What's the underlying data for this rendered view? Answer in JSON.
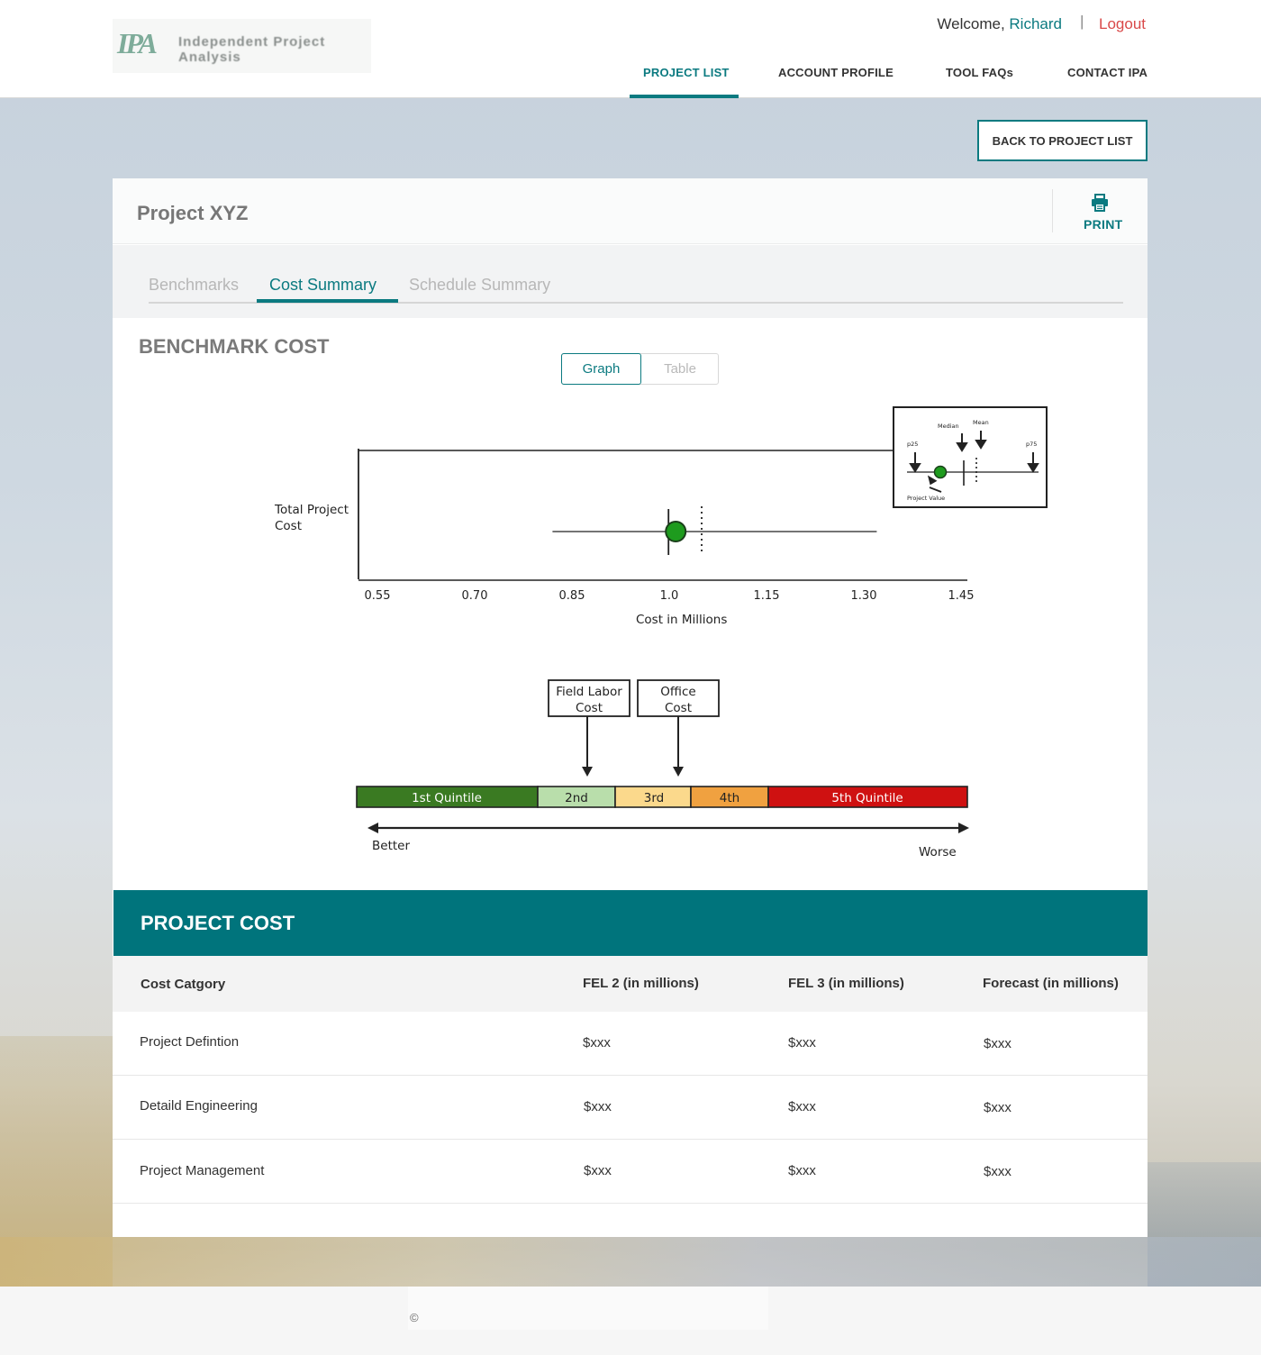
{
  "header": {
    "welcome_prefix": "Welcome,",
    "user_name": "Richard",
    "separator": "|",
    "logout_label": "Logout",
    "nav": [
      "PROJECT LIST",
      "ACCOUNT PROFILE",
      "TOOL FAQs",
      "CONTACT IPA"
    ],
    "active_nav": "PROJECT LIST"
  },
  "back_button_label": "BACK TO PROJECT LIST",
  "project": {
    "title": "Project XYZ",
    "print_label": "PRINT",
    "tabs": [
      "Benchmarks",
      "Cost Summary",
      "Schedule Summary"
    ],
    "active_tab": "Cost Summary"
  },
  "benchmark": {
    "title": "BENCHMARK COST",
    "toggle": {
      "graph_label": "Graph",
      "table_label": "Table",
      "active": "Graph"
    },
    "chart": {
      "y_label_line1": "Total Project",
      "y_label_line2": "Cost",
      "x_label": "Cost in Millions",
      "x_ticks": [
        "0.55",
        "0.70",
        "0.85",
        "1.0",
        "1.15",
        "1.30",
        "1.45"
      ],
      "project_value": 1.01,
      "mean_value": 1.05,
      "range_min": 0.82,
      "range_max": 1.32,
      "legend": {
        "median": "Median",
        "mean": "Mean",
        "p25": "p25",
        "p75": "p75",
        "project_value": "Project Value"
      }
    },
    "quintile": {
      "callouts": [
        {
          "line1": "Field Labor",
          "line2": "Cost"
        },
        {
          "line1": "Office",
          "line2": "Cost"
        }
      ],
      "bands": [
        {
          "label": "1st Quintile",
          "color": "#3a7a22"
        },
        {
          "label": "2nd",
          "color": "#b9deab"
        },
        {
          "label": "3rd",
          "color": "#fbd98c"
        },
        {
          "label": "4th",
          "color": "#f0a140"
        },
        {
          "label": "5th Quintile",
          "color": "#cf1111"
        }
      ],
      "better_label": "Better",
      "worse_label": "Worse"
    }
  },
  "project_cost": {
    "title": "PROJECT COST",
    "columns": [
      "Cost Catgory",
      "FEL 2 (in millions)",
      "FEL 3 (in millions)",
      "Forecast (in millions)"
    ],
    "rows": [
      [
        "Project Defintion",
        "$xxx",
        "$xxx",
        "$xxx"
      ],
      [
        "Detaild Engineering",
        "$xxx",
        "$xxx",
        "$xxx"
      ],
      [
        "Project Management",
        "$xxx",
        "$xxx",
        "$xxx"
      ]
    ]
  },
  "footer": {
    "copyright": "©"
  },
  "colors": {
    "accent": "#0b7a80",
    "logout": "#d94949",
    "header_bar": "#00747c"
  }
}
